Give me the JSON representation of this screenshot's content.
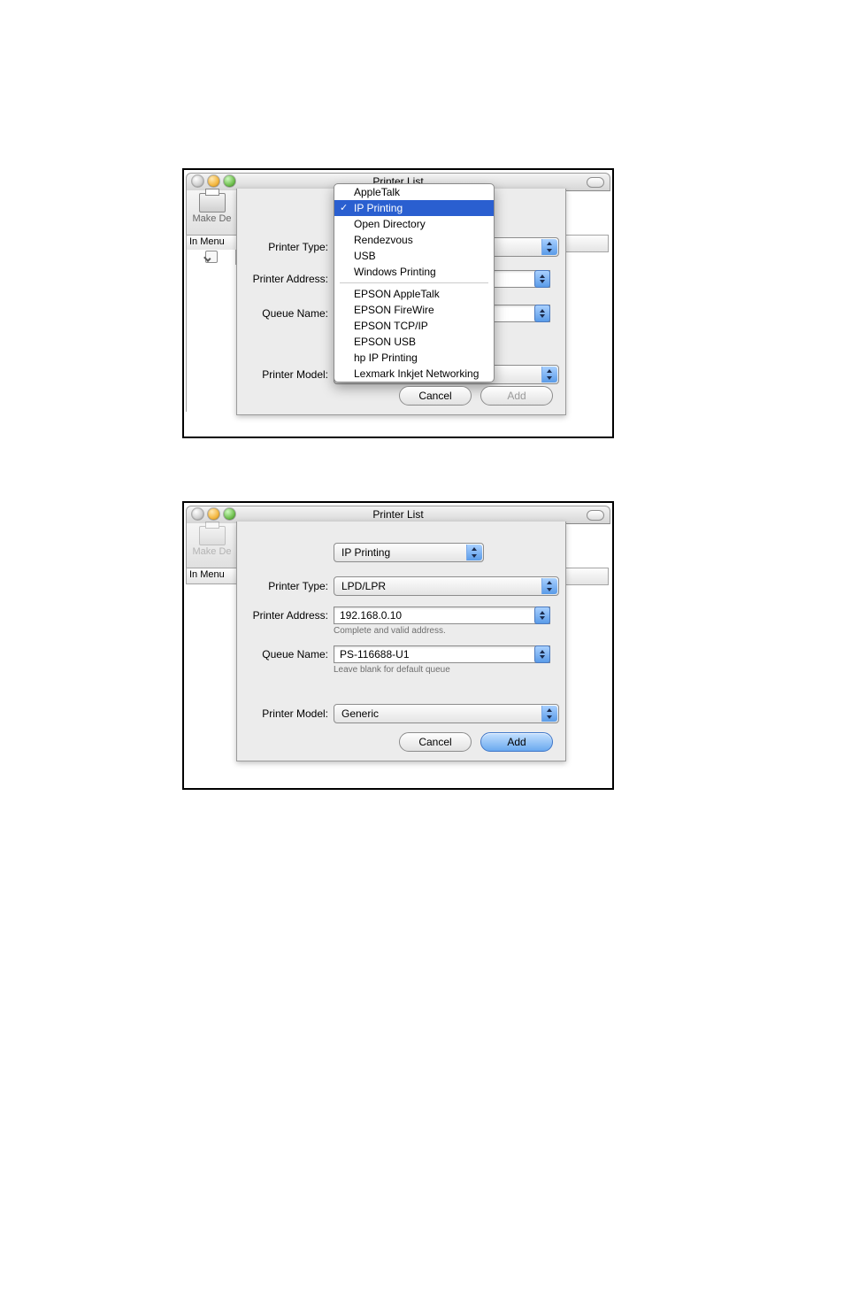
{
  "window_title": "Printer List",
  "toolbar": {
    "caption": "Make De"
  },
  "list": {
    "header": "In Menu"
  },
  "labels": {
    "printer_type": "Printer Type:",
    "printer_address": "Printer Address:",
    "queue_name": "Queue Name:",
    "printer_model": "Printer Model:"
  },
  "panel1": {
    "menu": [
      "AppleTalk",
      "IP Printing",
      "Open Directory",
      "Rendezvous",
      "USB",
      "Windows Printing",
      "-",
      "EPSON AppleTalk",
      "EPSON FireWire",
      "EPSON TCP/IP",
      "EPSON USB",
      "hp IP Printing",
      "Lexmark Inkjet Networking"
    ],
    "selected_index": 1,
    "buttons": {
      "cancel": "Cancel",
      "add": "Add"
    }
  },
  "panel2": {
    "connection": "IP Printing",
    "printer_type": "LPD/LPR",
    "printer_address": "192.168.0.10",
    "addr_hint": "Complete and valid address.",
    "queue_name": "PS-116688-U1",
    "queue_hint": "Leave blank for default queue",
    "printer_model": "Generic",
    "buttons": {
      "cancel": "Cancel",
      "add": "Add"
    }
  }
}
